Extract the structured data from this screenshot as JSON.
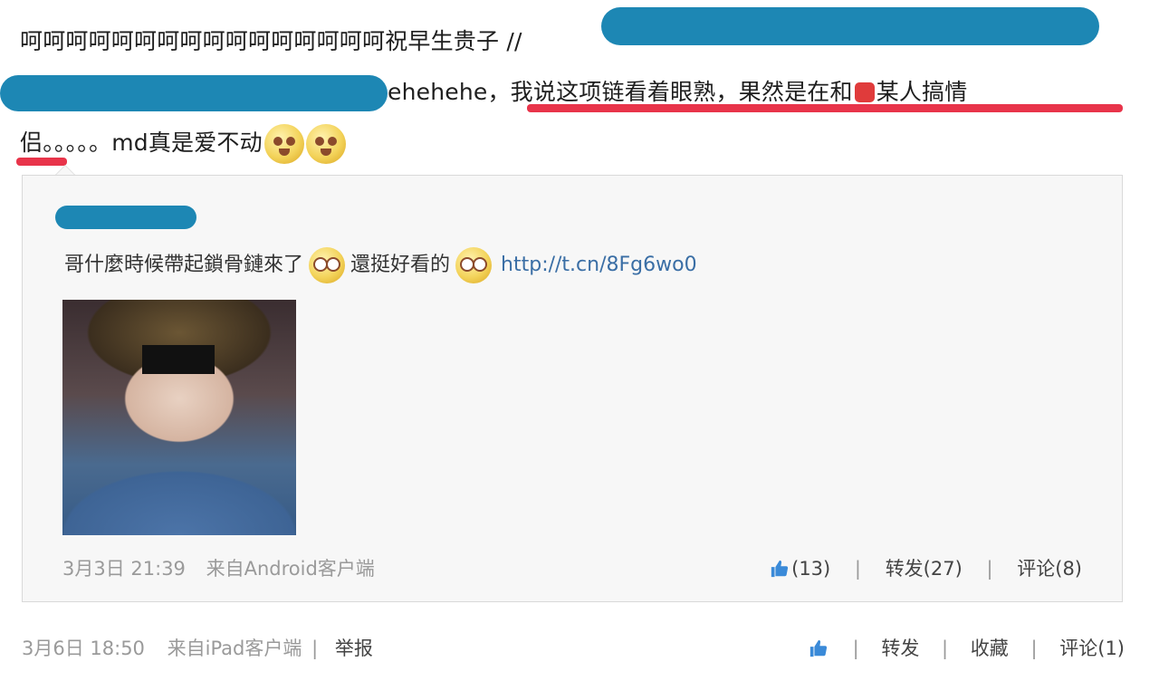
{
  "post": {
    "line1_text": "呵呵呵呵呵呵呵呵呵呵呵呵呵呵呵呵祝早生贵子 //",
    "line2_text_a": "ehehehe，",
    "line2_text_b": "我说这项链看着眼熟，果然是在和",
    "line2_text_c": "某人搞情",
    "line3_text": "侣。。。。。md真是爱不动"
  },
  "quote": {
    "text_a": "哥什麼時候帶起鎖骨鏈來了",
    "text_b": "還挺好看的",
    "link": "http://t.cn/8Fg6wo0",
    "date": "3月3日 21:39",
    "source": "来自Android客户端",
    "like_count": "(13)",
    "repost_label": "转发(27)",
    "comment_label": "评论(8)"
  },
  "footer": {
    "date": "3月6日 18:50",
    "source": "来自iPad客户端",
    "report_label": "举报",
    "repost_label": "转发",
    "favorite_label": "收藏",
    "comment_label": "评论(1)"
  },
  "colors": {
    "redaction": "#1d87b4",
    "underline": "#e8344a",
    "link": "#3a6ea5"
  },
  "icons": [
    "heart-icon",
    "emoji-icon",
    "thumbs-up-icon"
  ]
}
